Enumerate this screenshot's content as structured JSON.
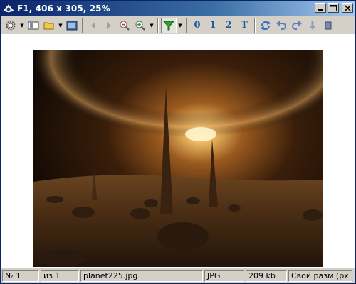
{
  "window": {
    "title": "F1, 406 x 305, 25%"
  },
  "toolbar": {
    "buttons": [
      "settings-icon",
      "thumbnails-icon",
      "open-folder-icon",
      "fullscreen-icon",
      "previous-icon",
      "next-icon",
      "zoom-out-icon",
      "zoom-in-icon",
      "filter-icon"
    ],
    "number_buttons": [
      "0",
      "1",
      "2"
    ],
    "text_button": "T"
  },
  "image": {
    "description_colors": [
      "#2a1606",
      "#7a4a1c",
      "#f4d9a0"
    ]
  },
  "statusbar": {
    "index": "№ 1",
    "total": "из 1",
    "filename": "planet225.jpg",
    "format": "JPG",
    "size": "209 kb",
    "zoom_mode": "Свой разм (рх"
  }
}
